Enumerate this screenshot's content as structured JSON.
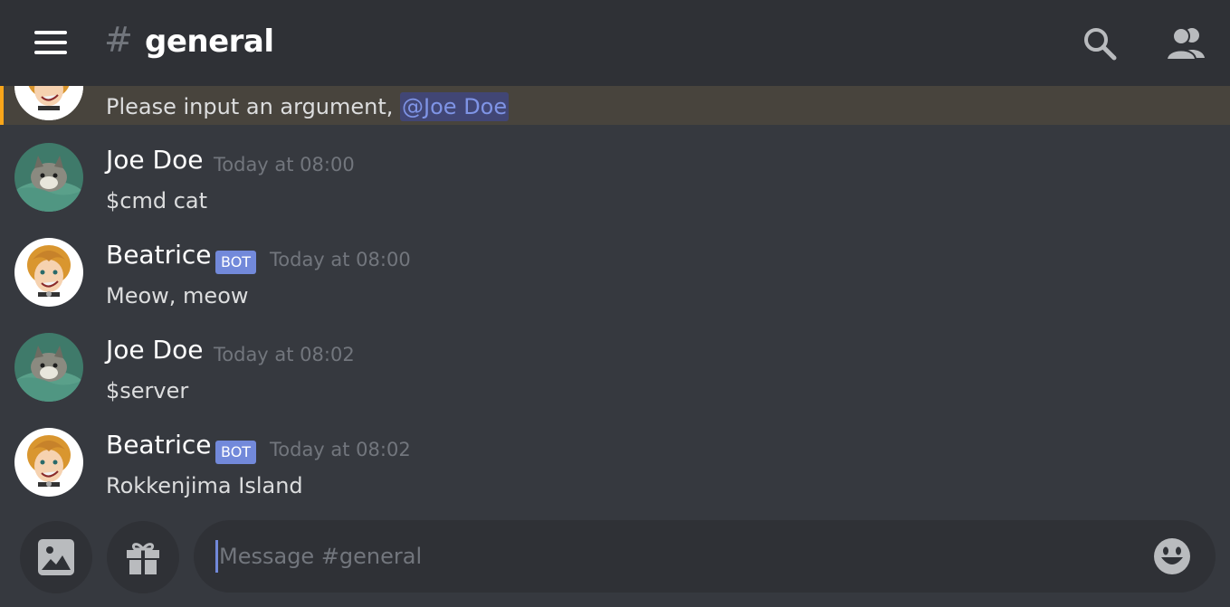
{
  "header": {
    "hash": "#",
    "channel_name": "general"
  },
  "mention": {
    "text": "Please input an argument, ",
    "tag": "@Joe Doe"
  },
  "messages": [
    {
      "author": "Joe Doe",
      "is_bot": false,
      "bot_label": "",
      "timestamp": "Today at 08:00",
      "content": "$cmd cat",
      "avatar": "cat-avatar"
    },
    {
      "author": "Beatrice",
      "is_bot": true,
      "bot_label": "BOT",
      "timestamp": "Today at 08:00",
      "content": "Meow, meow",
      "avatar": "beatrice-avatar"
    },
    {
      "author": "Joe Doe",
      "is_bot": false,
      "bot_label": "",
      "timestamp": "Today at 08:02",
      "content": "$server",
      "avatar": "cat-avatar"
    },
    {
      "author": "Beatrice",
      "is_bot": true,
      "bot_label": "BOT",
      "timestamp": "Today at 08:02",
      "content": "Rokkenjima Island",
      "avatar": "beatrice-avatar"
    }
  ],
  "composer": {
    "placeholder": "Message #general",
    "value": ""
  },
  "icons": {
    "menu": "hamburger-menu-icon",
    "search": "search-icon",
    "members": "members-icon",
    "image": "image-icon",
    "gift": "gift-icon",
    "emoji": "emoji-icon"
  },
  "colors": {
    "background": "#36393f",
    "header": "#2f3136",
    "mention_highlight": "#48443d",
    "mention_bar": "#faa61a",
    "mention_text": "#7f94e6",
    "bot_tag": "#7289da",
    "timestamp": "#72767d"
  }
}
